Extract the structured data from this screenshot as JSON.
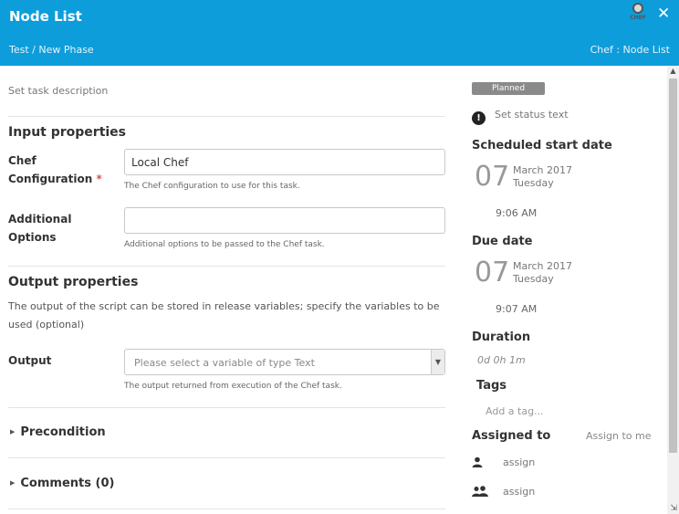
{
  "header": {
    "title": "Node List",
    "breadcrumb": "Test / New Phase",
    "plugin_label": "Chef : Node List",
    "logo_text": "CHEF",
    "close_glyph": "✕"
  },
  "task": {
    "description_placeholder": "Set task description"
  },
  "input_properties": {
    "heading": "Input properties",
    "chef_configuration": {
      "label_line1": "Chef",
      "label_line2": "Configuration",
      "required_mark": "*",
      "value": "Local Chef",
      "help": "The Chef configuration to use for this task."
    },
    "additional_options": {
      "label_line1": "Additional",
      "label_line2": "Options",
      "value": "",
      "help": "Additional options to be passed to the Chef task."
    }
  },
  "output_properties": {
    "heading": "Output properties",
    "description": "The output of the script can be stored in release variables; specify the variables to be used (optional)",
    "output": {
      "label": "Output",
      "placeholder": "Please select a variable of type Text",
      "help": "The output returned from execution of the Chef task."
    }
  },
  "sections": {
    "precondition": "Precondition",
    "comments": "Comments (0)"
  },
  "sidebar": {
    "status_badge": "Planned",
    "status_placeholder": "Set status text",
    "scheduled_start": {
      "heading": "Scheduled start date",
      "day": "07",
      "month_year": "March 2017",
      "weekday": "Tuesday",
      "time": "9:06 AM"
    },
    "due_date": {
      "heading": "Due date",
      "day": "07",
      "month_year": "March 2017",
      "weekday": "Tuesday",
      "time": "9:07 AM"
    },
    "duration": {
      "heading": "Duration",
      "value": "0d 0h 1m"
    },
    "tags": {
      "heading": "Tags",
      "placeholder": "Add a tag..."
    },
    "assigned_to": {
      "heading": "Assigned to",
      "assign_to_me": "Assign to me",
      "user_assign": "assign",
      "team_assign": "assign"
    }
  },
  "colors": {
    "header_bg": "#0d9ddb",
    "required": "#d9534f",
    "badge_bg": "#8a8a8a"
  },
  "icons": [
    "chef-logo-icon",
    "close-icon",
    "exclamation-icon",
    "user-icon",
    "team-icon",
    "chevron-right-icon",
    "chevron-down-icon",
    "scroll-up-icon",
    "resize-handle-icon"
  ]
}
